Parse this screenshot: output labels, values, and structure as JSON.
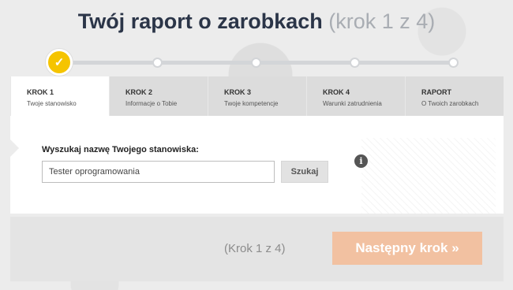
{
  "header": {
    "title": "Twój raport o zarobkach",
    "step_info": "(krok 1 z 4)"
  },
  "progress": {
    "completed_icon": "check-icon",
    "total_steps": 5,
    "current_step": 1
  },
  "tabs": [
    {
      "title": "KROK 1",
      "subtitle": "Twoje stanowisko",
      "active": true
    },
    {
      "title": "KROK 2",
      "subtitle": "Informacje o Tobie",
      "active": false
    },
    {
      "title": "KROK 3",
      "subtitle": "Twoje kompetencje",
      "active": false
    },
    {
      "title": "KROK 4",
      "subtitle": "Warunki zatrudnienia",
      "active": false
    },
    {
      "title": "RAPORT",
      "subtitle": "O Twoich zarobkach",
      "active": false
    }
  ],
  "form": {
    "label": "Wyszukaj nazwę Twojego stanowiska:",
    "input_value": "Tester oprogramowania",
    "search_button": "Szukaj",
    "info_icon": "info-icon"
  },
  "footer": {
    "step_text": "(Krok 1 z 4)",
    "next_button": "Następny krok »"
  },
  "colors": {
    "accent_yellow": "#f5c400",
    "next_button": "#f2c1a1",
    "title": "#2b3548"
  }
}
